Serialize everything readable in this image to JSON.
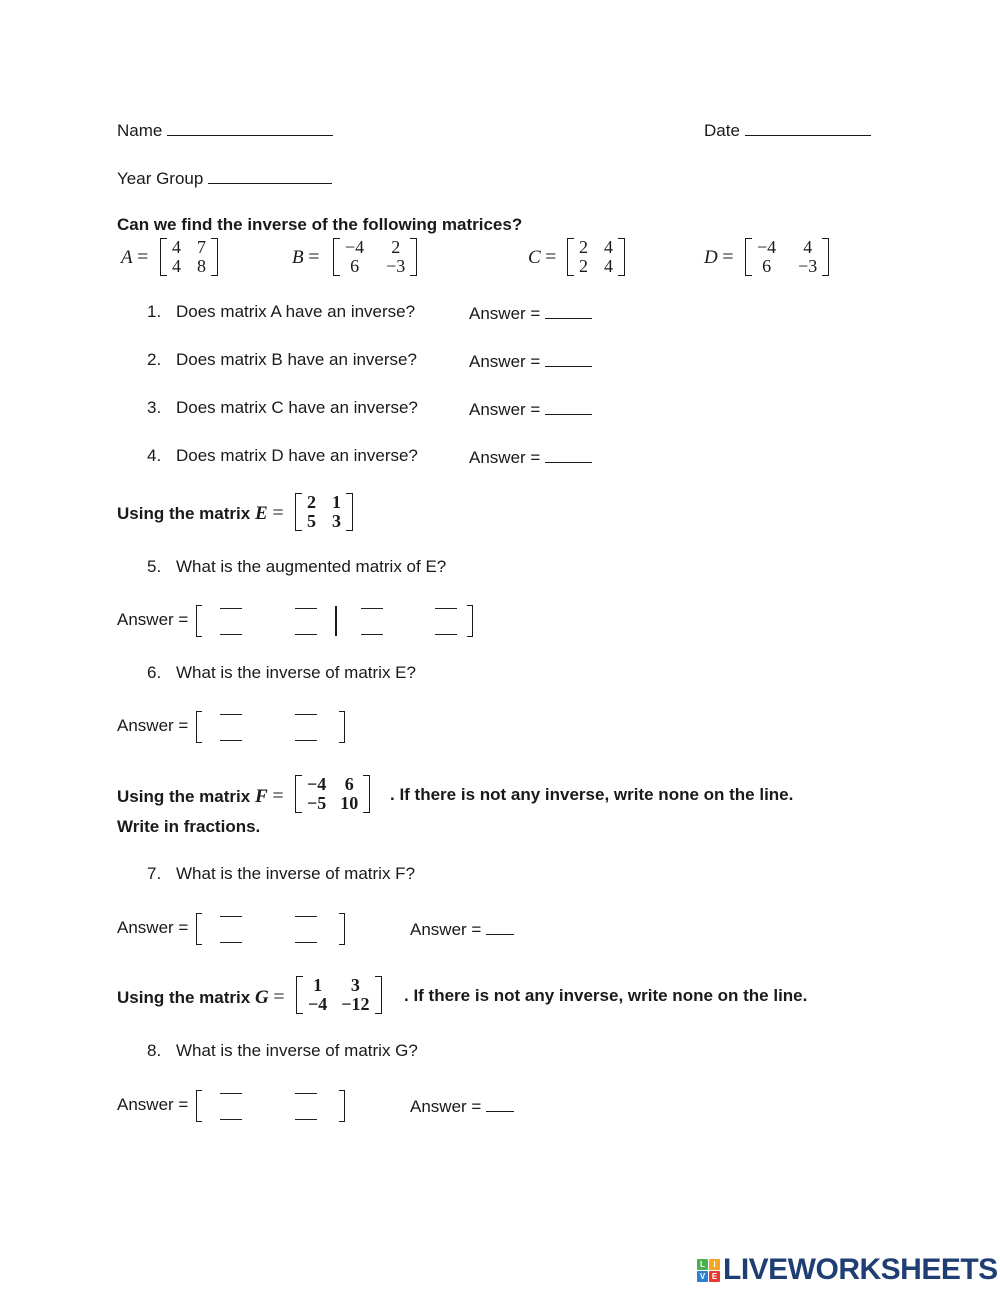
{
  "header": {
    "name_label": "Name",
    "date_label": "Date",
    "year_group_label": "Year Group"
  },
  "section1": {
    "heading": "Can we find the inverse of the following matrices?",
    "matrices": [
      {
        "name": "A",
        "values": [
          "4",
          "7",
          "4",
          "8"
        ]
      },
      {
        "name": "B",
        "values": [
          "−4",
          "2",
          "6",
          "−3"
        ]
      },
      {
        "name": "C",
        "values": [
          "2",
          "4",
          "2",
          "4"
        ]
      },
      {
        "name": "D",
        "values": [
          "−4",
          "4",
          "6",
          "−3"
        ]
      }
    ],
    "equals": "=",
    "questions": [
      {
        "number": "1.",
        "text": "Does matrix A have an inverse?",
        "answer_label": "Answer ="
      },
      {
        "number": "2.",
        "text": "Does matrix B have an inverse?",
        "answer_label": "Answer ="
      },
      {
        "number": "3.",
        "text": "Does matrix C have an inverse?",
        "answer_label": "Answer ="
      },
      {
        "number": "4.",
        "text": "Does matrix D have an inverse?",
        "answer_label": "Answer ="
      }
    ]
  },
  "section2": {
    "intro": "Using the matrix",
    "matrix_name": "E",
    "matrix_values": [
      "2",
      "1",
      "5",
      "3"
    ],
    "questions": [
      {
        "number": "5.",
        "text": "What is the augmented matrix of E?",
        "answer_label": "Answer ="
      },
      {
        "number": "6.",
        "text": "What is the inverse of matrix E?",
        "answer_label": "Answer ="
      }
    ]
  },
  "section3": {
    "intro": "Using the matrix",
    "matrix_name": "F",
    "matrix_values": [
      "−4",
      "6",
      "−5",
      "10"
    ],
    "instruction": ". If there is not any inverse, write none on the line.",
    "instruction2": "Write in fractions.",
    "question": {
      "number": "7.",
      "text": "What is the inverse of matrix F?",
      "answer_label": "Answer =",
      "answer_label2": "Answer ="
    }
  },
  "section4": {
    "intro": "Using the matrix",
    "matrix_name": "G",
    "matrix_values": [
      "1",
      "3",
      "−4",
      "−12"
    ],
    "instruction": ". If there is not any inverse, write none on the line.",
    "question": {
      "number": "8.",
      "text": "What is the inverse of matrix G?",
      "answer_label": "Answer =",
      "answer_label2": "Answer ="
    }
  },
  "logo": {
    "tiles": [
      "L",
      "I",
      "V",
      "E"
    ],
    "tile_colors": [
      "#4caf50",
      "#f5a623",
      "#2f7fd1",
      "#e53935"
    ],
    "text": "LIVEWORKSHEETS",
    "brand_color": "#1f3e73"
  }
}
